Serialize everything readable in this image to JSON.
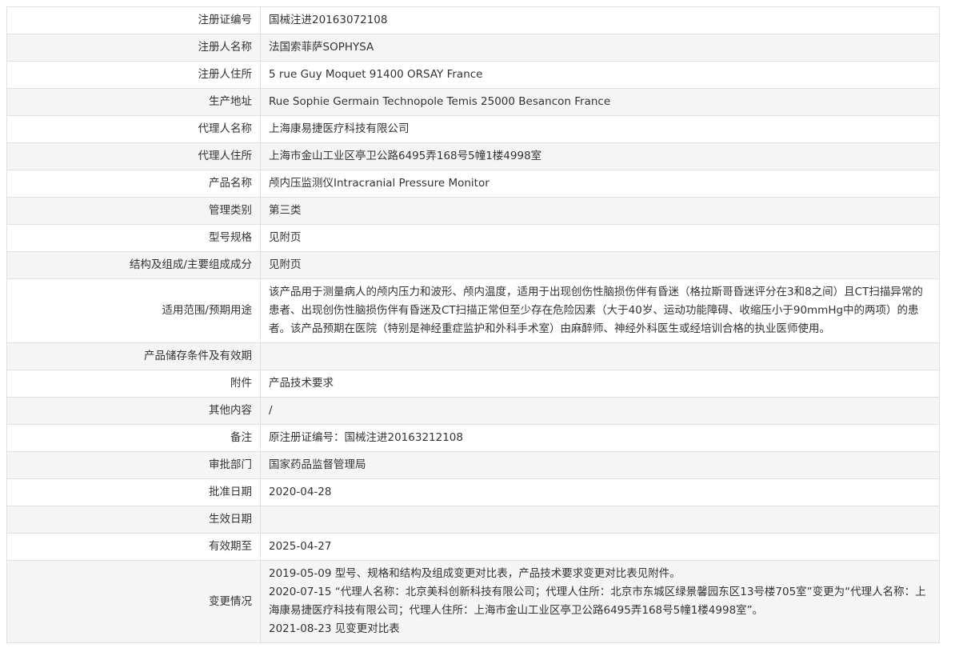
{
  "rows": [
    {
      "label": "注册证编号",
      "value": "国械注进20163072108"
    },
    {
      "label": "注册人名称",
      "value": "法国索菲萨SOPHYSA"
    },
    {
      "label": "注册人住所",
      "value": "5 rue Guy Moquet 91400 ORSAY France"
    },
    {
      "label": "生产地址",
      "value": "Rue Sophie Germain Technopole Temis 25000 Besancon France"
    },
    {
      "label": "代理人名称",
      "value": "上海康易捷医疗科技有限公司"
    },
    {
      "label": "代理人住所",
      "value": "上海市金山工业区亭卫公路6495弄168号5幢1楼4998室"
    },
    {
      "label": "产品名称",
      "value": "颅内压监测仪Intracranial Pressure Monitor"
    },
    {
      "label": "管理类别",
      "value": "第三类"
    },
    {
      "label": "型号规格",
      "value": "见附页"
    },
    {
      "label": "结构及组成/主要组成成分",
      "value": "见附页"
    },
    {
      "label": "适用范围/预期用途",
      "value": "该产品用于测量病人的颅内压力和波形、颅内温度，适用于出现创伤性脑损伤伴有昏迷（格拉斯哥昏迷评分在3和8之间）且CT扫描异常的患者、出现创伤性脑损伤伴有昏迷及CT扫描正常但至少存在危险因素（大于40岁、运动功能障碍、收缩压小于90mmHg中的两项）的患者。该产品预期在医院（特别是神经重症监护和外科手术室）由麻醉师、神经外科医生或经培训合格的执业医师使用。"
    },
    {
      "label": "产品储存条件及有效期",
      "value": ""
    },
    {
      "label": "附件",
      "value": "产品技术要求"
    },
    {
      "label": "其他内容",
      "value": "/"
    },
    {
      "label": "备注",
      "value": "原注册证编号：国械注进20163212108"
    },
    {
      "label": "审批部门",
      "value": "国家药品监督管理局"
    },
    {
      "label": "批准日期",
      "value": "2020-04-28"
    },
    {
      "label": "生效日期",
      "value": ""
    },
    {
      "label": "有效期至",
      "value": "2025-04-27"
    },
    {
      "label": "变更情况",
      "lines": [
        "2019-05-09 型号、规格和结构及组成变更对比表，产品技术要求变更对比表见附件。",
        "2020-07-15 “代理人名称：北京美科创新科技有限公司；代理人住所：北京市东城区绿景馨园东区13号楼705室”变更为“代理人名称：上海康易捷医疗科技有限公司；代理人住所：上海市金山工业区亭卫公路6495弄168号5幢1楼4998室”。",
        "2021-08-23 见变更对比表"
      ]
    }
  ]
}
